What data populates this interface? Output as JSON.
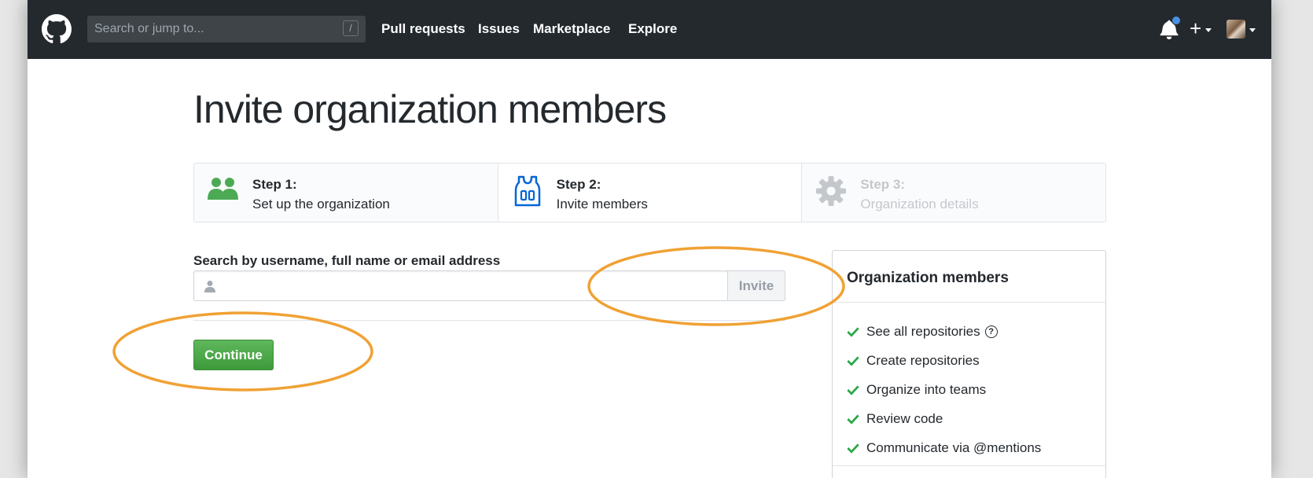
{
  "header": {
    "search_placeholder": "Search or jump to...",
    "search_shortcut": "/",
    "nav": [
      "Pull requests",
      "Issues",
      "Marketplace",
      "Explore"
    ],
    "notifications_unread": true
  },
  "page": {
    "title": "Invite organization members"
  },
  "steps": [
    {
      "title": "Step 1:",
      "desc": "Set up the organization",
      "state": "complete",
      "icon": "people-icon"
    },
    {
      "title": "Step 2:",
      "desc": "Invite members",
      "state": "current",
      "icon": "jersey-icon"
    },
    {
      "title": "Step 3:",
      "desc": "Organization details",
      "state": "disabled",
      "icon": "gear-icon"
    }
  ],
  "form": {
    "label": "Search by username, full name or email address",
    "input_value": "",
    "invite_label": "Invite",
    "continue_label": "Continue"
  },
  "sidebar": {
    "title": "Organization members",
    "permissions": [
      "See all repositories",
      "Create repositories",
      "Organize into teams",
      "Review code",
      "Communicate via @mentions"
    ]
  },
  "colors": {
    "header_bg": "#24292e",
    "accent_green": "#2cbe4e",
    "annotation_orange": "#f0a134",
    "step_blue": "#0366d6"
  }
}
